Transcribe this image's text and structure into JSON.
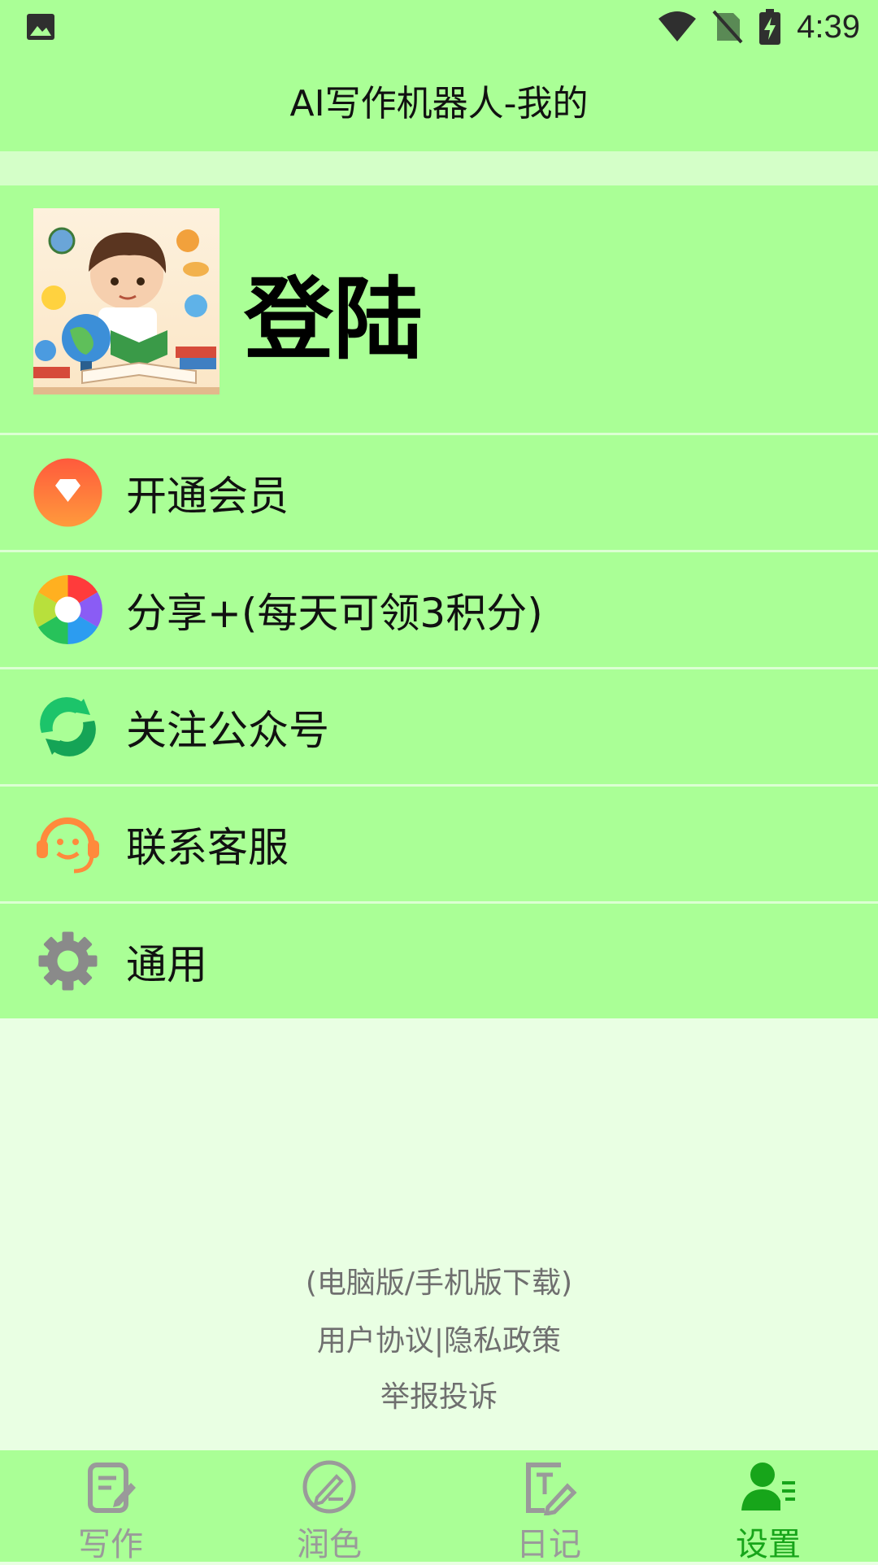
{
  "status_bar": {
    "time": "4:39"
  },
  "header": {
    "title": "AI写作机器人-我的"
  },
  "profile": {
    "login_label": "登陆"
  },
  "menu": {
    "items": [
      {
        "label": "开通会员",
        "icon": "diamond-icon"
      },
      {
        "label": "分享+(每天可领3积分)",
        "icon": "share-aperture-icon"
      },
      {
        "label": "关注公众号",
        "icon": "official-account-icon"
      },
      {
        "label": "联系客服",
        "icon": "customer-service-icon"
      },
      {
        "label": "通用",
        "icon": "gear-icon"
      }
    ]
  },
  "footer": {
    "download": "(电脑版/手机版下载)",
    "agreement": "用户协议|隐私政策",
    "report": "举报投诉"
  },
  "tabs": [
    {
      "label": "写作",
      "icon": "write-icon",
      "active": false
    },
    {
      "label": "润色",
      "icon": "polish-icon",
      "active": false
    },
    {
      "label": "日记",
      "icon": "diary-icon",
      "active": false
    },
    {
      "label": "设置",
      "icon": "user-settings-icon",
      "active": true
    }
  ],
  "colors": {
    "header_bg": "#aaff96",
    "page_bg": "#e9ffe3",
    "active_tab": "#17a51a",
    "inactive_tab": "#9a9a9a"
  }
}
